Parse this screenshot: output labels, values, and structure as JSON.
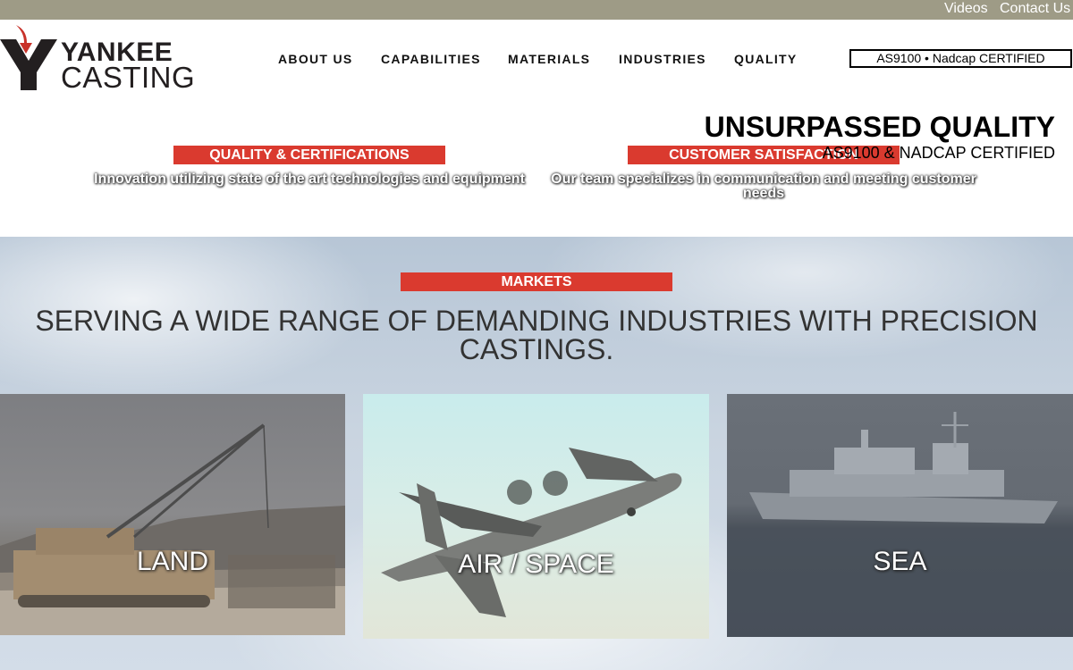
{
  "topbar": {
    "videos": "Videos",
    "contact": "Contact Us"
  },
  "logo": {
    "line1": "YANKEE",
    "line2": "CASTING"
  },
  "nav": [
    "ABOUT US",
    "CAPABILITIES",
    "MATERIALS",
    "INDUSTRIES",
    "QUALITY"
  ],
  "cert_badge": "AS9100 • Nadcap CERTIFIED",
  "hero": {
    "title": "UNSURPASSED QUALITY",
    "subtitle": "AS9100 & NADCAP CERTIFIED",
    "quality_pill": "QUALITY & CERTIFICATIONS",
    "quality_text": "Innovation utilizing state of the art technologies and equipment",
    "customer_pill": "CUSTOMER SATISFACTION",
    "customer_text": "Our team specializes in communication and meeting customer needs"
  },
  "markets": {
    "pill": "MARKETS",
    "title": "SERVING A WIDE RANGE OF DEMANDING INDUSTRIES WITH PRECISION CASTINGS.",
    "cards": [
      {
        "label": "LAND"
      },
      {
        "label": "AIR / SPACE"
      },
      {
        "label": "SEA"
      }
    ]
  },
  "colors": {
    "topbar": "#9e9b86",
    "accent_red": "#da3a2f",
    "logo_red": "#c8322a"
  }
}
